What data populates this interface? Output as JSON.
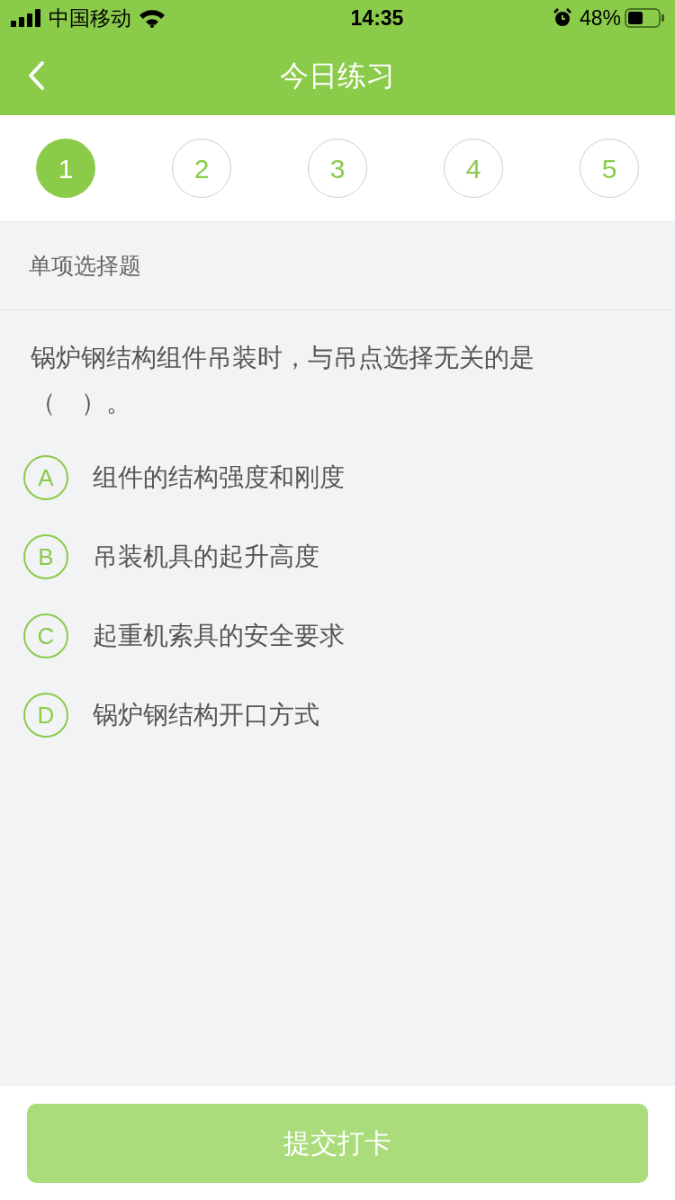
{
  "status_bar": {
    "carrier": "中国移动",
    "time": "14:35",
    "battery": "48%"
  },
  "nav": {
    "title": "今日练习"
  },
  "steps": [
    {
      "label": "1",
      "selected": true
    },
    {
      "label": "2",
      "selected": false
    },
    {
      "label": "3",
      "selected": false
    },
    {
      "label": "4",
      "selected": false
    },
    {
      "label": "5",
      "selected": false
    }
  ],
  "section": {
    "title": "单项选择题"
  },
  "question": {
    "text": "锅炉钢结构组件吊装时，与吊点选择无关的是（　）。"
  },
  "options": [
    {
      "letter": "A",
      "text": "组件的结构强度和刚度",
      "selected": false
    },
    {
      "letter": "B",
      "text": "吊装机具的起升高度",
      "selected": false
    },
    {
      "letter": "C",
      "text": "起重机索具的安全要求",
      "selected": false
    },
    {
      "letter": "D",
      "text": "锅炉钢结构开口方式",
      "selected": false
    }
  ],
  "submit": {
    "label": "提交打卡",
    "disabled": true
  }
}
